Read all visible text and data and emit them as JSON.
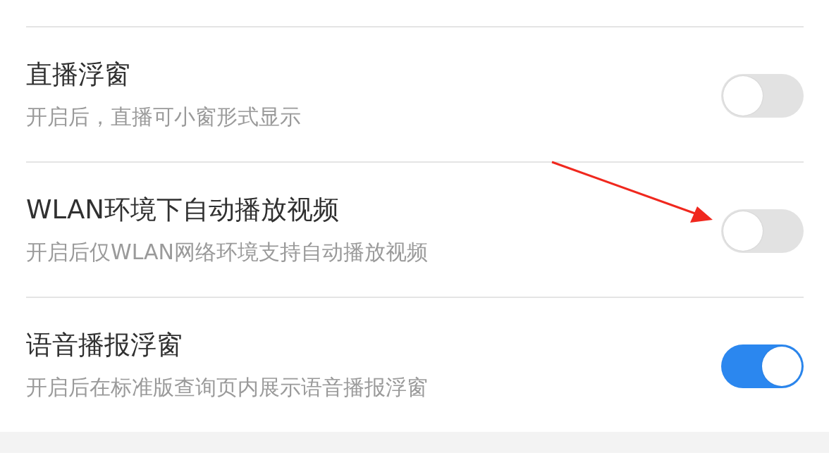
{
  "settings": [
    {
      "title": "直播浮窗",
      "description": "开启后，直播可小窗形式显示",
      "on": false
    },
    {
      "title": "WLAN环境下自动播放视频",
      "description": "开启后仅WLAN网络环境支持自动播放视频",
      "on": false
    },
    {
      "title": "语音播报浮窗",
      "description": "开启后在标准版查询页内展示语音播报浮窗",
      "on": true
    }
  ]
}
